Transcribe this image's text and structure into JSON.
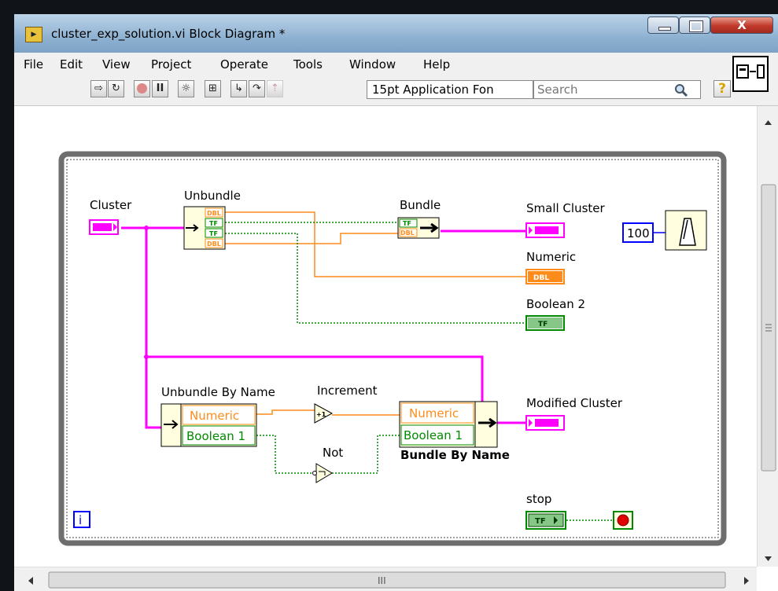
{
  "window": {
    "title": "cluster_exp_solution.vi Block Diagram *",
    "app_icon": "labview-vi-icon",
    "caption_buttons": [
      "minimize",
      "maximize",
      "close"
    ]
  },
  "menu": [
    "File",
    "Edit",
    "View",
    "Project",
    "Operate",
    "Tools",
    "Window",
    "Help"
  ],
  "toolbar": {
    "buttons": [
      "run-arrow-icon",
      "run-continuously-icon",
      "abort-icon",
      "pause-icon",
      "highlight-execution-icon",
      "retain-wire-values-icon",
      "step-into-icon",
      "step-over-icon",
      "step-out-icon"
    ],
    "font_select": "15pt Application Fon",
    "search_placeholder": "Search",
    "help_label": "?"
  },
  "diagram": {
    "labels": {
      "cluster": "Cluster",
      "unbundle": "Unbundle",
      "bundle": "Bundle",
      "small_cluster": "Small Cluster",
      "numeric": "Numeric",
      "boolean2": "Boolean 2",
      "unbundle_by_name": "Unbundle By Name",
      "increment": "Increment",
      "not": "Not",
      "bundle_by_name": "Bundle By Name",
      "modified_cluster": "Modified Cluster",
      "stop": "stop",
      "wait_constant": "100",
      "iteration": "i"
    },
    "unbundle_terminals": [
      "DBL",
      "TF",
      "TF",
      "DBL"
    ],
    "bundle_terminals": [
      "TF",
      "DBL"
    ],
    "unbundle_by_name_items": [
      "Numeric",
      "Boolean 1"
    ],
    "bundle_by_name_items": [
      "Numeric",
      "Boolean 1"
    ],
    "terminal_types": {
      "numeric": "DBL",
      "boolean": "TF"
    },
    "colors": {
      "cluster_wire": "#ff00ff",
      "numeric_wire": "#ff8c1a",
      "boolean_wire": "#008a00",
      "const_blue": "#0000ff",
      "loop_border": "#555555"
    }
  },
  "status": {
    "hscroll_grip": "III"
  }
}
